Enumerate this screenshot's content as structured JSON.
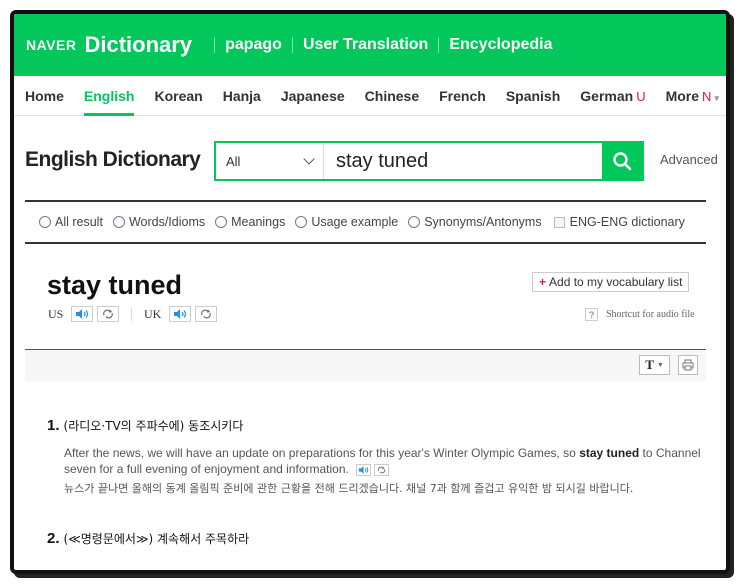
{
  "gnb": {
    "logo": "NAVER",
    "title": "Dictionary",
    "links": [
      "papago",
      "User Translation",
      "Encyclopedia"
    ]
  },
  "tabs": [
    {
      "label": "Home",
      "active": false
    },
    {
      "label": "English",
      "active": true
    },
    {
      "label": "Korean",
      "active": false
    },
    {
      "label": "Hanja",
      "active": false
    },
    {
      "label": "Japanese",
      "active": false
    },
    {
      "label": "Chinese",
      "active": false
    },
    {
      "label": "French",
      "active": false
    },
    {
      "label": "Spanish",
      "active": false
    },
    {
      "label": "German",
      "badge": "U",
      "active": false
    },
    {
      "label": "More",
      "badge": "N",
      "caret": "▾",
      "active": false
    }
  ],
  "search": {
    "site_title": "English Dictionary",
    "scope": "All",
    "query": "stay tuned",
    "advanced_label": "Advanced"
  },
  "filters": {
    "radios": [
      "All result",
      "Words/Idioms",
      "Meanings",
      "Usage example",
      "Synonyms/Antonyms"
    ],
    "checkbox": "ENG-ENG dictionary"
  },
  "entry": {
    "word": "stay tuned",
    "add_vocab": "Add to my vocabulary list",
    "pron_us": "US",
    "pron_uk": "UK",
    "shortcut_q": "?",
    "shortcut_label": "Shortcut for audio file",
    "font_btn": "T"
  },
  "meanings": [
    {
      "num": "1.",
      "text": "(라디오·TV의 주파수에) 동조시키다",
      "example_pre": "After the news, we will have an update on preparations for this year's Winter Olympic Games, so ",
      "example_bold": "stay tuned",
      "example_post": " to Channel seven for a full evening of enjoyment and information.",
      "example_ko": "뉴스가 끝나면 올해의 동계 올림픽 준비에 관한 근황을 전해 드리겠습니다. 채널 7과 함께 즐겁고 유익한 밤 되시길 바랍니다."
    },
    {
      "num": "2.",
      "text": "(≪명령문에서≫) 계속해서 주목하라"
    }
  ],
  "colors": {
    "brand_green": "#03c75a",
    "badge_red": "#e4154c",
    "audio_blue": "#2a8ee6"
  }
}
